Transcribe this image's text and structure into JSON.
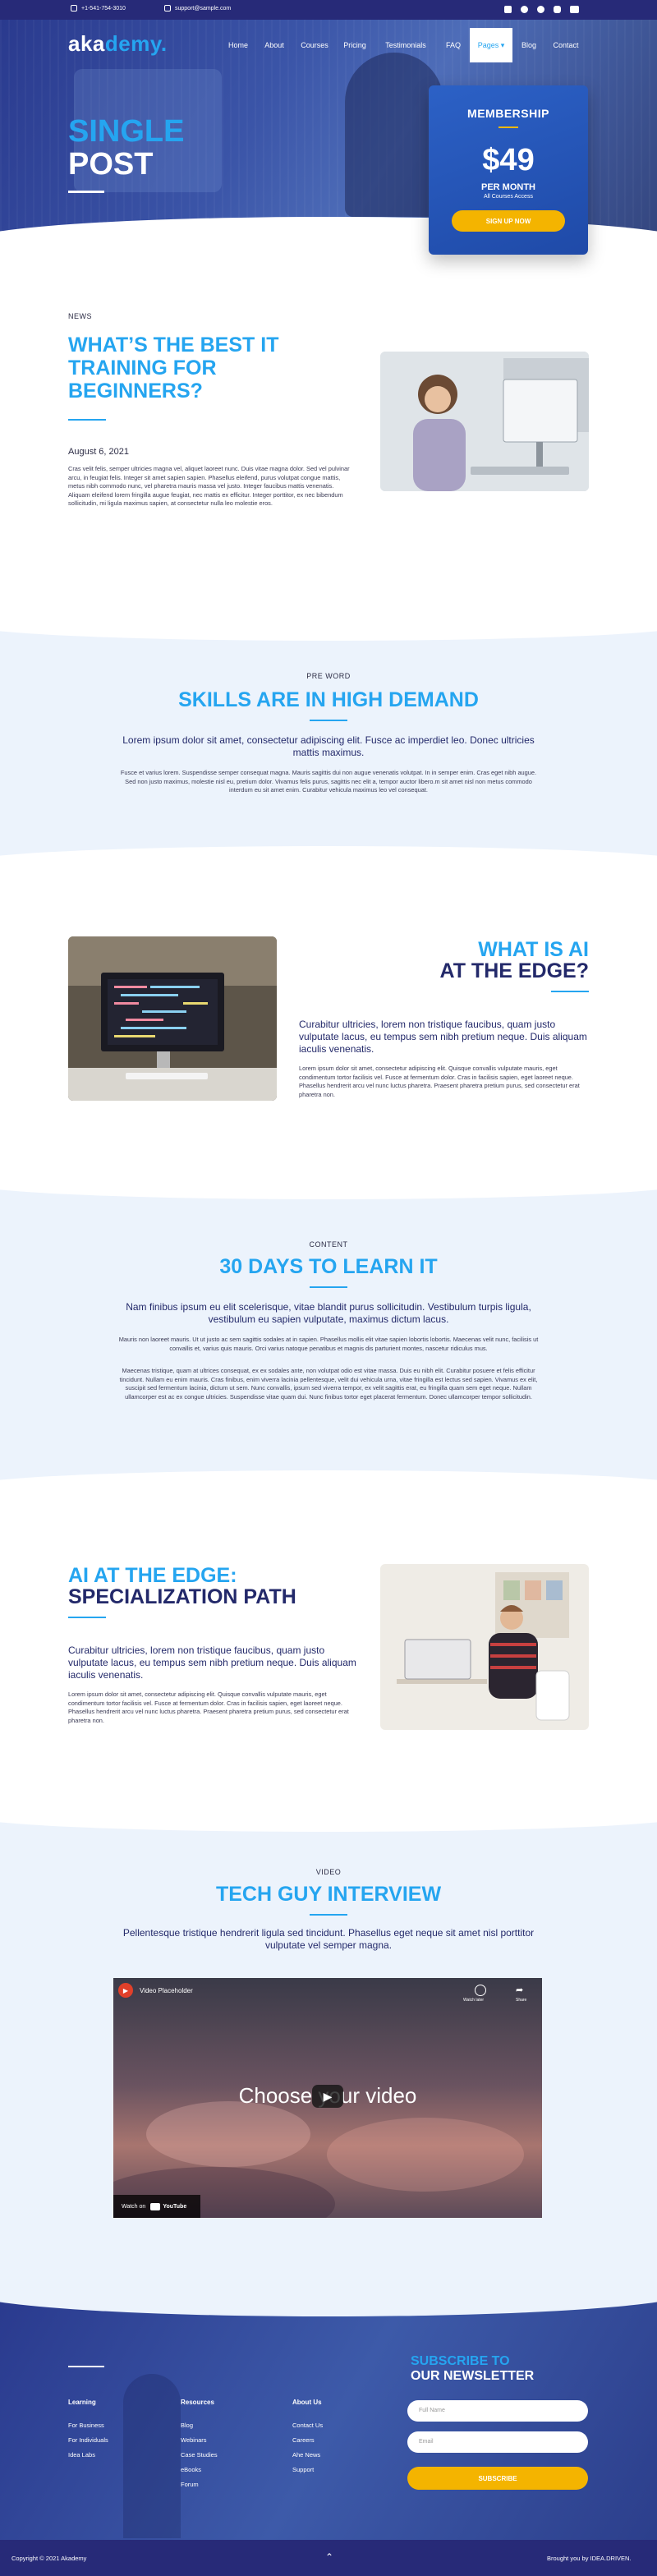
{
  "topbar": {
    "phone": "+1-541-754-3010",
    "email": "support@sample.com",
    "social": [
      "linkedin-icon",
      "facebook-icon",
      "twitter-icon",
      "instagram-icon",
      "youtube-icon"
    ]
  },
  "header": {
    "logo_a": "aka",
    "logo_b": "demy.",
    "nav": [
      {
        "label": "Home"
      },
      {
        "label": "About"
      },
      {
        "label": "Courses"
      },
      {
        "label": "Pricing"
      },
      {
        "label": "Testimonials"
      },
      {
        "label": "FAQ"
      },
      {
        "label": "Pages ▾",
        "active": true
      },
      {
        "label": "Blog"
      },
      {
        "label": "Contact"
      }
    ]
  },
  "hero": {
    "title_line1": "SINGLE",
    "title_line2": "POST"
  },
  "membership": {
    "title": "MEMBERSHIP",
    "price": "$49",
    "period": "PER MONTH",
    "access": "All Courses Access",
    "button": "SIGN UP NOW"
  },
  "article": {
    "tag": "NEWS",
    "title": "WHAT’S THE BEST IT TRAINING FOR BEGINNERS?",
    "date": "August 6, 2021",
    "body": "Cras velit felis, semper ultricies magna vel, aliquet laoreet nunc. Duis vitae magna dolor. Sed vel pulvinar arcu, in feugiat felis. Integer sit amet sapien sapien. Phasellus eleifend, purus volutpat congue mattis, metus nibh commodo nunc, vel pharetra mauris massa vel justo. Integer faucibus mattis venenatis. Aliquam eleifend lorem fringilla augue feugiat, nec mattis ex efficitur. Integer porttitor, ex nec bibendum sollicitudin, mi ligula maximus sapien, at consectetur nulla leo molestie eros."
  },
  "skills": {
    "tag": "PRE WORD",
    "title": "SKILLS ARE IN HIGH DEMAND",
    "lead": "Lorem ipsum dolor sit amet, consectetur adipiscing elit. Fusce ac imperdiet leo. Donec ultricies mattis maximus.",
    "body": "Fusce et varius lorem. Suspendisse semper consequat magna. Mauris sagittis dui non augue venenatis volutpat. In in semper enim. Cras eget nibh augue. Sed non justo maximus, molestie nisl eu, pretium dolor. Vivamus felis purus, sagittis nec elit a, tempor auctor libero.m sit amet nisl non metus commodo interdum eu sit amet enim. Curabitur vehicula maximus leo vel consequat."
  },
  "ai": {
    "title_line1": "WHAT IS AI",
    "title_line2": "AT THE EDGE?",
    "lead": "Curabitur ultricies, lorem non tristique faucibus, quam justo vulputate lacus, eu tempus sem nibh pretium neque. Duis aliquam iaculis venenatis.",
    "body": "Lorem ipsum dolor sit amet, consectetur adipiscing elit. Quisque convallis vulputate mauris, eget condimentum tortor facilisis vel. Fusce at fermentum dolor. Cras in facilisis sapien, eget laoreet neque. Phasellus hendrerit arcu vel nunc luctus pharetra. Praesent pharetra pretium purus, sed consectetur erat pharetra non."
  },
  "content": {
    "tag": "CONTENT",
    "title": "30 DAYS TO LEARN IT",
    "lead": "Nam finibus ipsum eu elit scelerisque, vitae blandit purus sollicitudin. Vestibulum turpis ligula, vestibulum eu sapien vulputate, maximus dictum lacus.",
    "body1": "Mauris non laoreet mauris. Ut ut justo ac sem sagittis sodales at in sapien. Phasellus mollis elit vitae sapien lobortis lobortis. Maecenas velit nunc, facilisis ut convallis et, varius quis mauris. Orci varius natoque penatibus et magnis dis parturient montes, nascetur ridiculus mus.",
    "body2": "Maecenas tristique, quam at ultrices consequat, ex ex sodales ante, non volutpat odio est vitae massa. Duis eu nibh elit. Curabitur posuere et felis efficitur tincidunt. Nullam eu enim mauris. Cras finibus, enim viverra lacinia pellentesque, velit dui vehicula urna, vitae fringilla est lectus sed sapien. Vivamus ex elit, suscipit sed fermentum lacinia, dictum ut sem. Nunc convallis, ipsum sed viverra tempor, ex velit sagittis erat, eu fringilla quam sem eget neque. Nullam ullamcorper est ac ex congue ultricies. Suspendisse vitae quam dui. Nunc finibus tortor eget placerat fermentum. Donec ullamcorper tempor sollicitudin."
  },
  "spec": {
    "title_line1": "AI AT THE EDGE:",
    "title_line2": "SPECIALIZATION PATH",
    "lead": "Curabitur ultricies, lorem non tristique faucibus, quam justo vulputate lacus, eu tempus sem nibh pretium neque. Duis aliquam iaculis venenatis.",
    "body": "Lorem ipsum dolor sit amet, consectetur adipiscing elit. Quisque convallis vulputate mauris, eget condimentum tortor facilisis vel. Fusce at fermentum dolor. Cras in facilisis sapien, eget laoreet neque. Phasellus hendrerit arcu vel nunc luctus pharetra. Praesent pharetra pretium purus, sed consectetur erat pharetra non."
  },
  "video_section": {
    "tag": "VIDEO",
    "title": "TECH GUY INTERVIEW",
    "lead": "Pellentesque tristique hendrerit ligula sed tincidunt. Phasellus eget neque sit amet nisl porttitor vulputate vel semper magna.",
    "player": {
      "title": "Video Placeholder",
      "overlay": "Choose your video",
      "watch_on": "Watch on",
      "brand": "YouTube",
      "watch_later": "Watch later",
      "share": "Share"
    }
  },
  "footer": {
    "columns": [
      {
        "heading": "Learning",
        "links": [
          "For Business",
          "For Individuals",
          "Idea Labs"
        ]
      },
      {
        "heading": "Resources",
        "links": [
          "Blog",
          "Webinars",
          "Case Studies",
          "eBooks",
          "Forum"
        ]
      },
      {
        "heading": "About Us",
        "links": [
          "Contact Us",
          "Careers",
          "Ahe News",
          "Support"
        ]
      }
    ],
    "newsletter": {
      "title1": "SUBSCRIBE TO",
      "title2": "OUR NEWSLETTER",
      "name_placeholder": "Full Name",
      "email_placeholder": "Email",
      "button": "SUBSCRIBE"
    },
    "copyright": "Copyright © 2021 Akademy",
    "brought": "Brought you by IDEA.DRIVEN."
  },
  "colors": {
    "accent": "#25a5f0",
    "navy": "#23296a",
    "gold": "#f4b400",
    "band": "#ecf3fc"
  }
}
